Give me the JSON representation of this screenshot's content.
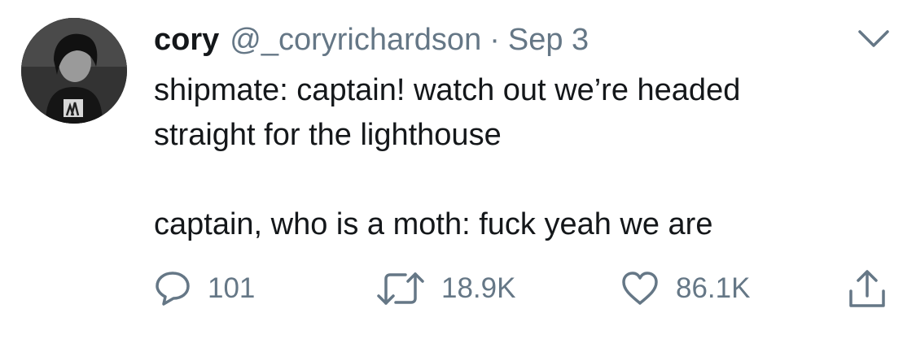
{
  "tweet": {
    "author": {
      "name": "cory",
      "handle": "@_coryrichardson"
    },
    "separator": "·",
    "date": "Sep 3",
    "text_lines": [
      "shipmate: captain! watch out we’re headed\nstraight for the lighthouse",
      "captain, who is a moth: fuck yeah we are"
    ],
    "actions": {
      "reply_count": "101",
      "retweet_count": "18.9K",
      "like_count": "86.1K"
    }
  },
  "icons": {
    "menu": "chevron-down-icon",
    "reply": "speech-bubble-icon",
    "retweet": "retweet-arrows-icon",
    "like": "heart-icon",
    "share": "share-upload-icon"
  },
  "colors": {
    "text_primary": "#14171a",
    "text_secondary": "#657786",
    "background": "#ffffff"
  }
}
